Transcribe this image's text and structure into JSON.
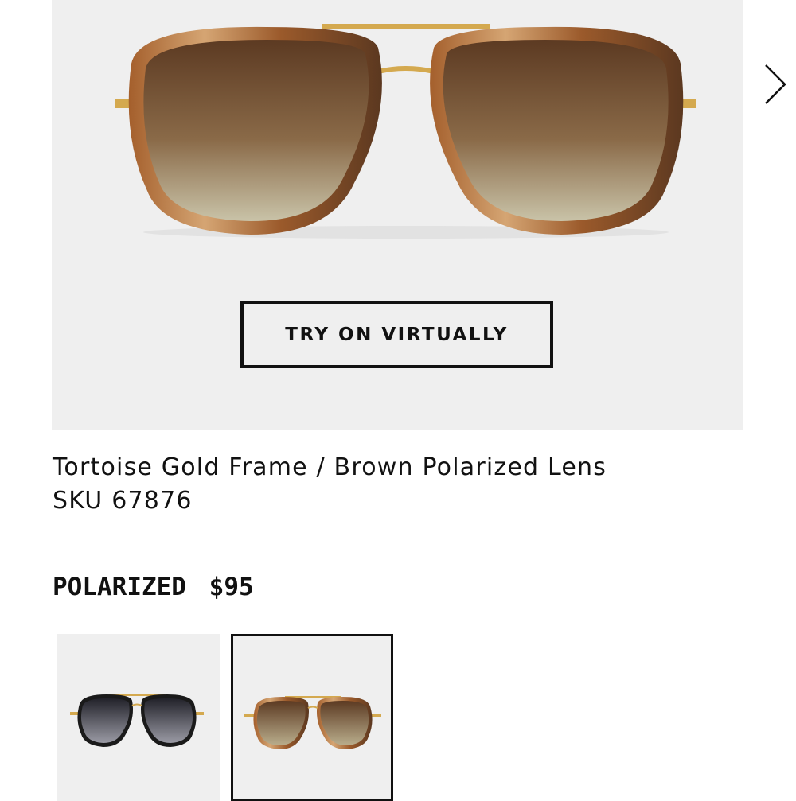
{
  "product": {
    "frame_name": "Tortoise Gold Frame / Brown Polarized Lens",
    "sku_label": "SKU",
    "sku_value": "67876"
  },
  "actions": {
    "try_on_label": "TRY ON VIRTUALLY"
  },
  "lens": {
    "type_label": "POLARIZED",
    "price": "$95"
  },
  "variants": [
    {
      "name": "Black Gold Frame",
      "selected": false,
      "lens_color": "#2c2c34"
    },
    {
      "name": "Tortoise Gold Frame",
      "selected": true,
      "lens_color": "#7a4a25"
    }
  ],
  "colors": {
    "hero_bg": "#efefef",
    "frame_tortoise": "#b06a35",
    "gold": "#d4a94f",
    "text": "#111111"
  },
  "icons": {
    "next": "chevron-right-icon"
  }
}
